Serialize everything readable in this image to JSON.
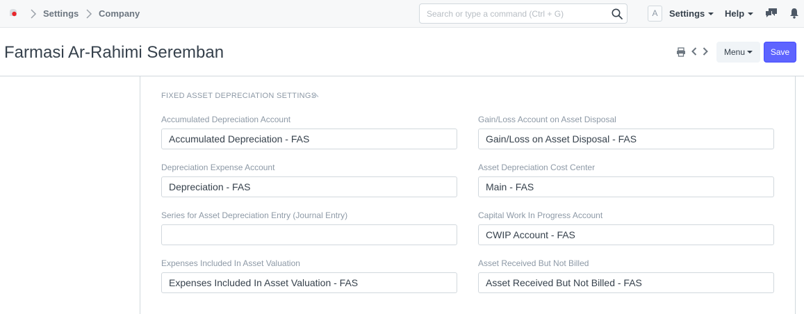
{
  "navbar": {
    "breadcrumbs": [
      "Settings",
      "Company"
    ],
    "search_placeholder": "Search or type a command (Ctrl + G)",
    "avatar_letter": "A",
    "settings_label": "Settings",
    "help_label": "Help"
  },
  "page": {
    "title": "Farmasi Ar-Rahimi Seremban",
    "menu_label": "Menu",
    "save_label": "Save",
    "accent_color": "#5e64ff"
  },
  "section": {
    "title": "FIXED ASSET DEPRECIATION SETTINGS",
    "left_fields": [
      {
        "label": "Accumulated Depreciation Account",
        "value": "Accumulated Depreciation - FAS"
      },
      {
        "label": "Depreciation Expense Account",
        "value": "Depreciation - FAS"
      },
      {
        "label": "Series for Asset Depreciation Entry (Journal Entry)",
        "value": ""
      },
      {
        "label": "Expenses Included In Asset Valuation",
        "value": "Expenses Included In Asset Valuation - FAS"
      }
    ],
    "right_fields": [
      {
        "label": "Gain/Loss Account on Asset Disposal",
        "value": "Gain/Loss on Asset Disposal - FAS"
      },
      {
        "label": "Asset Depreciation Cost Center",
        "value": "Main - FAS"
      },
      {
        "label": "Capital Work In Progress Account",
        "value": "CWIP Account - FAS"
      },
      {
        "label": "Asset Received But Not Billed",
        "value": "Asset Received But Not Billed - FAS"
      }
    ]
  }
}
